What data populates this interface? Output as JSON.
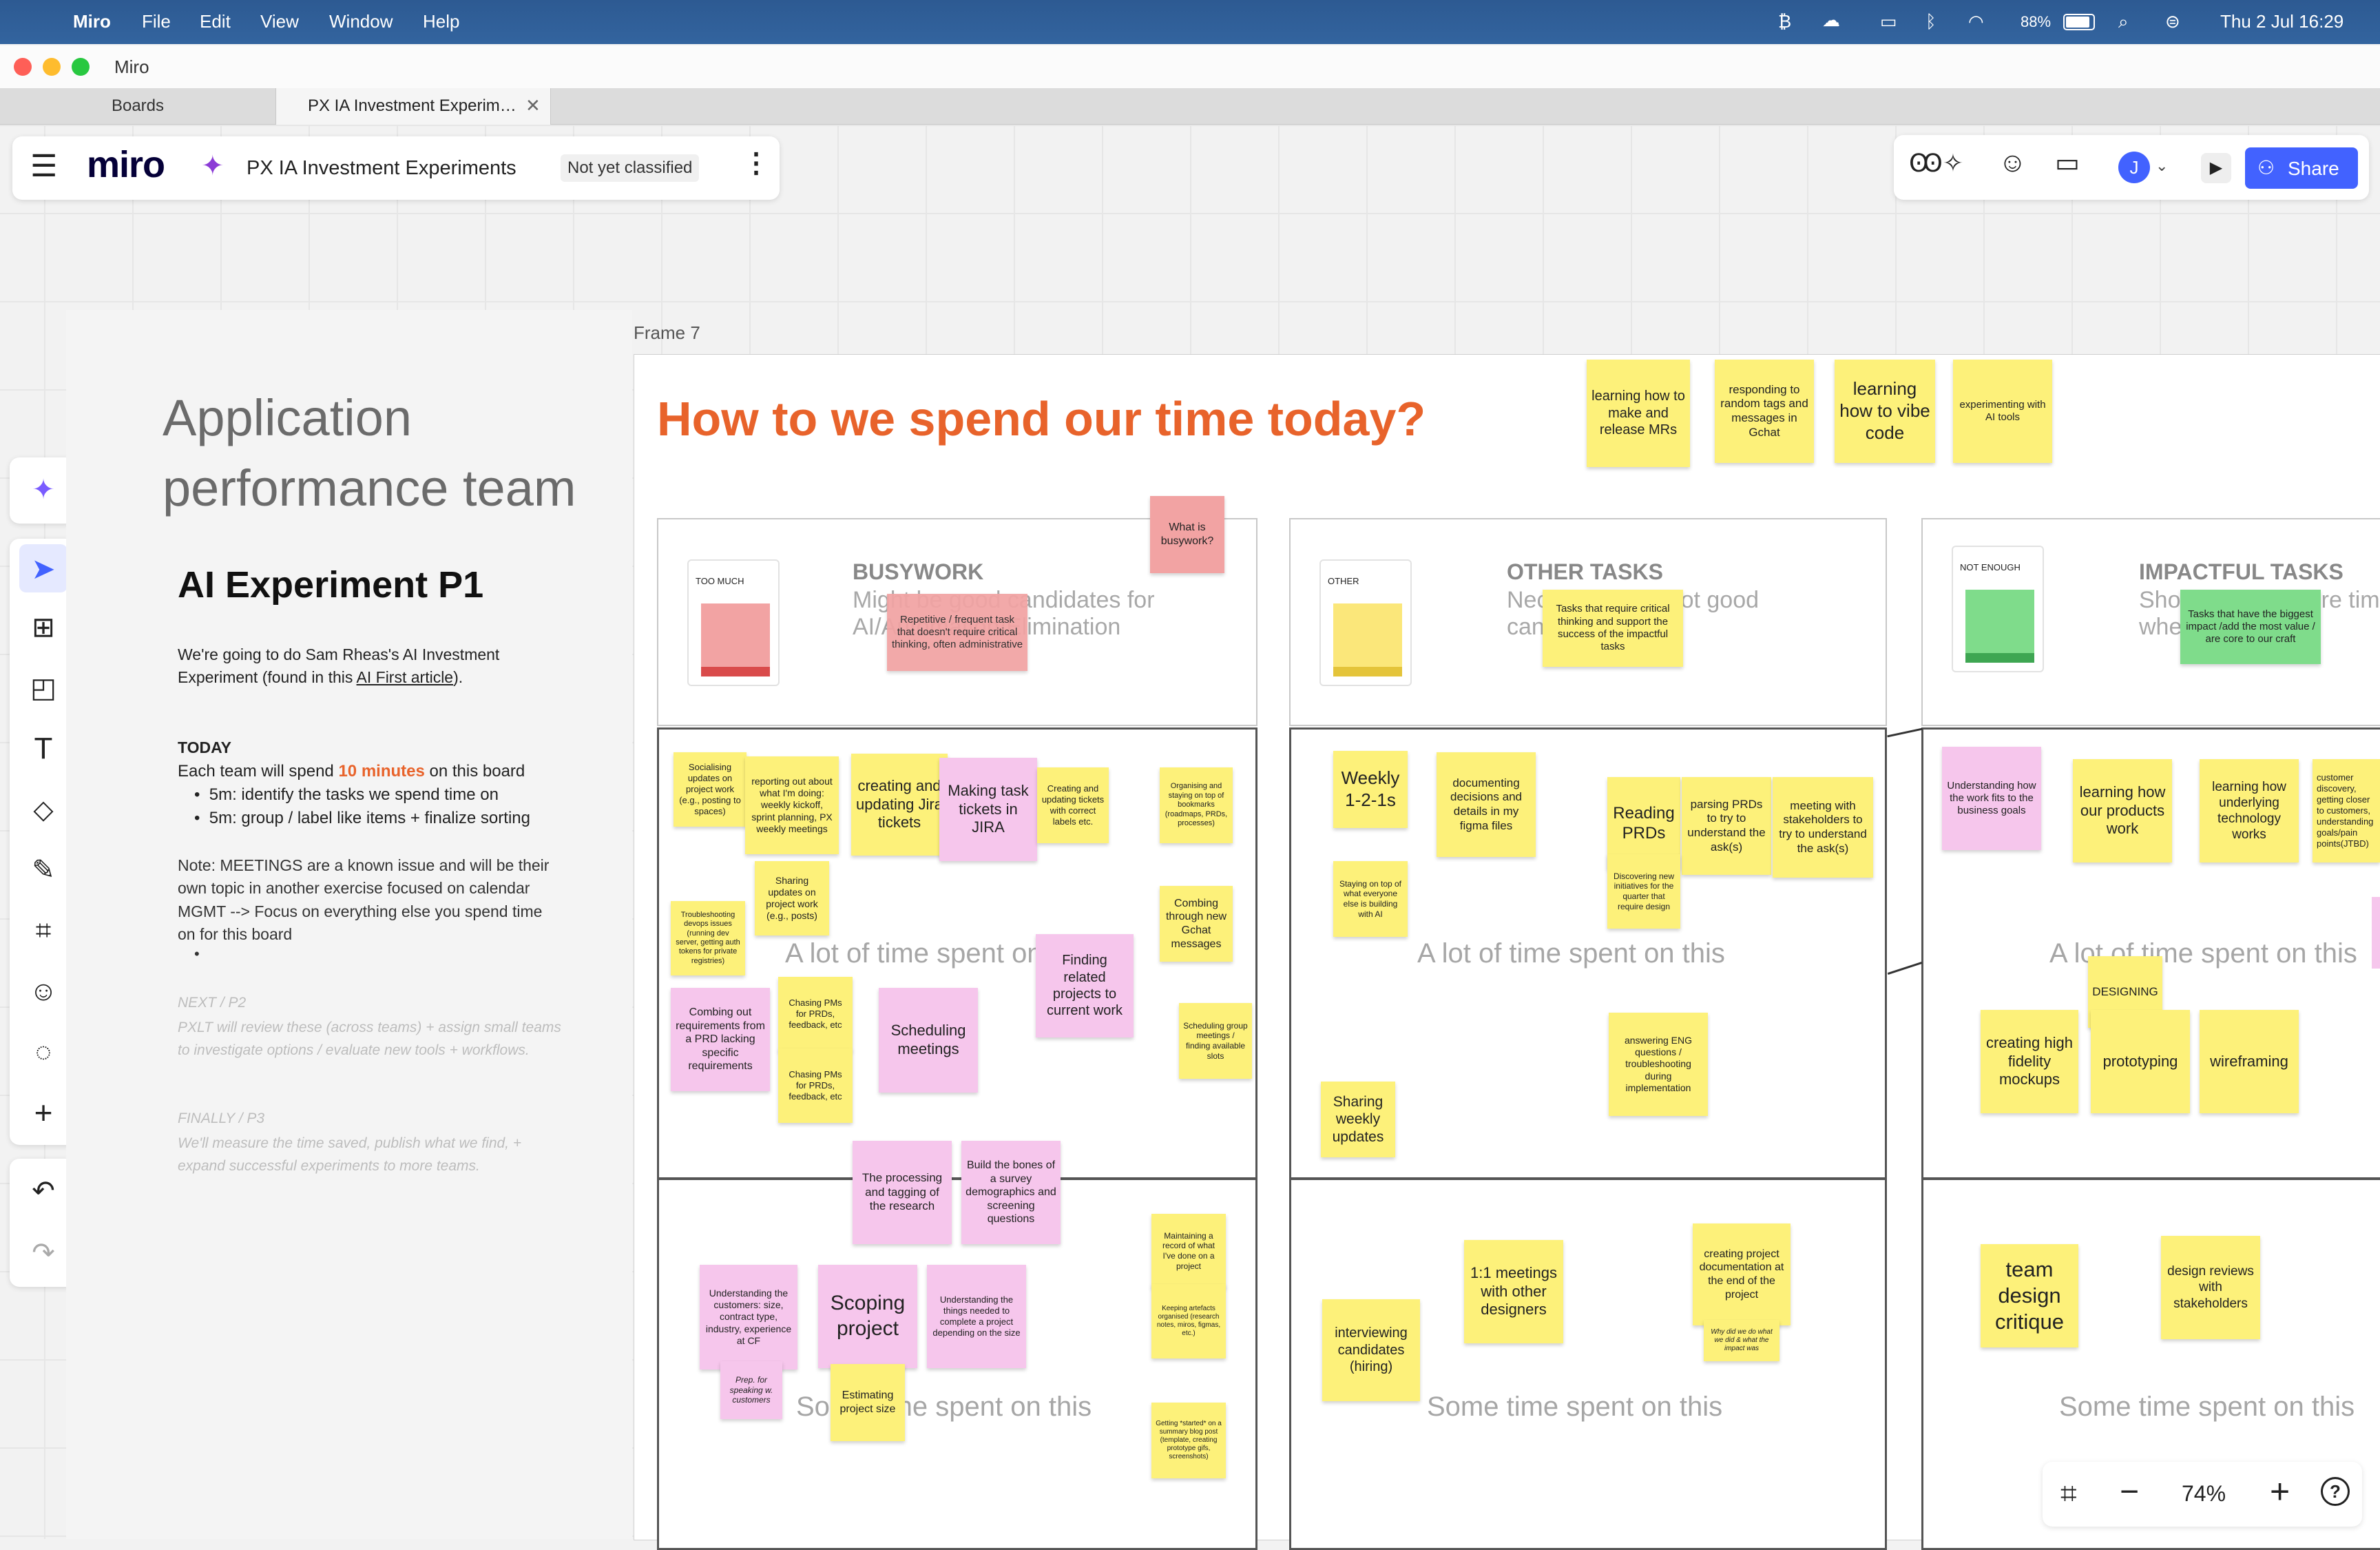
{
  "menubar": {
    "app": "Miro",
    "items": [
      "File",
      "Edit",
      "View",
      "Window",
      "Help"
    ],
    "battery": "88%",
    "datetime": "Thu 2 Jul  16:29"
  },
  "window": {
    "title": "Miro"
  },
  "tabs": [
    {
      "label": "Boards"
    },
    {
      "label": "PX IA Investment Experim…"
    }
  ],
  "board_header": {
    "logo": "miro",
    "board_name": "PX IA Investment Experiments",
    "classification": "Not yet classified"
  },
  "share_button": "Share",
  "avatar_initial": "J",
  "zoom": "74%",
  "frame_label": "Frame 7",
  "left_notes": {
    "team_title": "Application performance team",
    "experiment_title": "AI Experiment P1",
    "intro_before": "We're going to do Sam Rheas's AI Investment Experiment (found in this ",
    "intro_link": "AI First article",
    "intro_after": ").",
    "today_heading": "TODAY",
    "today_before": "Each team will spend ",
    "today_highlight": "10 minutes",
    "today_after": " on this board",
    "bullets": [
      "5m: identify the tasks we spend time on",
      "5m: group / label like items + finalize sorting"
    ],
    "note": "Note: MEETINGS are a known issue and will be their own topic in another exercise focused on calendar MGMT  --> Focus on everything else you spend time on for this board",
    "empty_bullet": "•",
    "next_heading": "NEXT / P2",
    "next_text": "PXLT will review these (across teams) +  assign small teams to investigate options / evaluate new tools + workflows.",
    "finally_heading": "FINALLY / P3",
    "finally_text": "We'll measure the time saved,  publish what we find, + expand successful experiments to more teams."
  },
  "main_title": "How to we spend our time today?",
  "top_stickies": [
    "learning how to make and release MRs",
    "responding to random tags and messages in Gchat",
    "learning how to vibe code",
    "experimenting with AI tools"
  ],
  "what_is_busywork": "What is busywork?",
  "columns": {
    "busywork": {
      "legend": "TOO MUCH",
      "title": "BUSYWORK",
      "subtitle": "Might be good candidates for AI/Automation/Elimination",
      "overlay": "Repetitive / frequent task that doesn't require critical thinking, often administrative"
    },
    "other": {
      "legend": "OTHER",
      "title": "OTHER TASKS",
      "subtitle": "Necessary, but not good candidates for AI",
      "overlay": "Tasks that require critical thinking and support the success of the impactful tasks"
    },
    "impactful": {
      "legend": "NOT ENOUGH",
      "title": "IMPACTFUL TASKS",
      "subtitle": "Should spend more time where our time",
      "overlay": "Tasks that have the biggest impact /add the most value / are core to our craft"
    }
  },
  "row_labels": {
    "a_lot": "A lot of time spent on this",
    "some": "Some time spent on this"
  },
  "stickies": {
    "busy_alot": [
      "Socialising updates on project work (e.g., posting to spaces)",
      "reporting out about what I'm doing: weekly kickoff, sprint planning, PX weekly meetings",
      "creating and updating Jira tickets",
      "Making task tickets in JIRA",
      "Creating and updating tickets with correct labels etc.",
      "Organising and staying on top of bookmarks (roadmaps, PRDs, processes)",
      "Sharing updates on project work (e.g., posts)",
      "Troubleshooting devops issues (running dev server, getting auth tokens for private registries)",
      "Combing through new Gchat messages",
      "Finding related projects to current work",
      "Combing out requirements from a PRD lacking specific requirements",
      "Chasing PMs for PRDs, feedback, etc",
      "Scheduling meetings",
      "Chasing PMs for PRDs, feedback, etc",
      "Scheduling group meetings / finding available slots"
    ],
    "busy_some": [
      "The processing and tagging of the research",
      "Build the bones of a survey demographics and screening questions",
      "Maintaining a record of what I've done on a project",
      "Keeping artefacts organised (research notes, miros, figmas, etc.)",
      "Understanding the customers: size, contract type, industry, experience at CF",
      "Scoping project",
      "Understanding the things needed to complete a project depending on the size",
      "Prep. for speaking w. customers",
      "Estimating project size",
      "Getting *started* on a summary blog post (template, creating prototype gifs, screenshots)"
    ],
    "other_alot": [
      "Weekly 1-2-1s",
      "documenting decisions and details in my figma files",
      "Reading PRDs",
      "parsing PRDs to try to understand the ask(s)",
      "meeting with stakeholders to try to understand the ask(s)",
      "Staying on top of what everyone else is building with AI",
      "Discovering new initiatives for the quarter that require design",
      "answering ENG questions / troubleshooting during implementation",
      "Sharing weekly updates"
    ],
    "other_some": [
      "1:1 meetings with other designers",
      "creating project documentation at the end of the project",
      "Why did we do what we did & what the impact was",
      "interviewing candidates (hiring)"
    ],
    "impact_alot": [
      "Understanding how the work fits to the business goals",
      "learning how our products work",
      "learning how underlying technology works",
      "customer discovery, getting closer to customers, understanding goals/pain points(JTBD)",
      "DESIGNING",
      "creating high fidelity mockups",
      "prototyping",
      "wireframing"
    ],
    "impact_some": [
      "team design critique",
      "design reviews with stakeholders"
    ]
  },
  "colors": {
    "menubar": "#2d5a92",
    "accent": "#4262ff",
    "title_orange": "#e8632b",
    "sticky_yellow": "#fdf17a",
    "sticky_pink": "#f6c6ec",
    "sticky_red": "#f2a3a3",
    "sticky_green": "#7fdc8b"
  }
}
